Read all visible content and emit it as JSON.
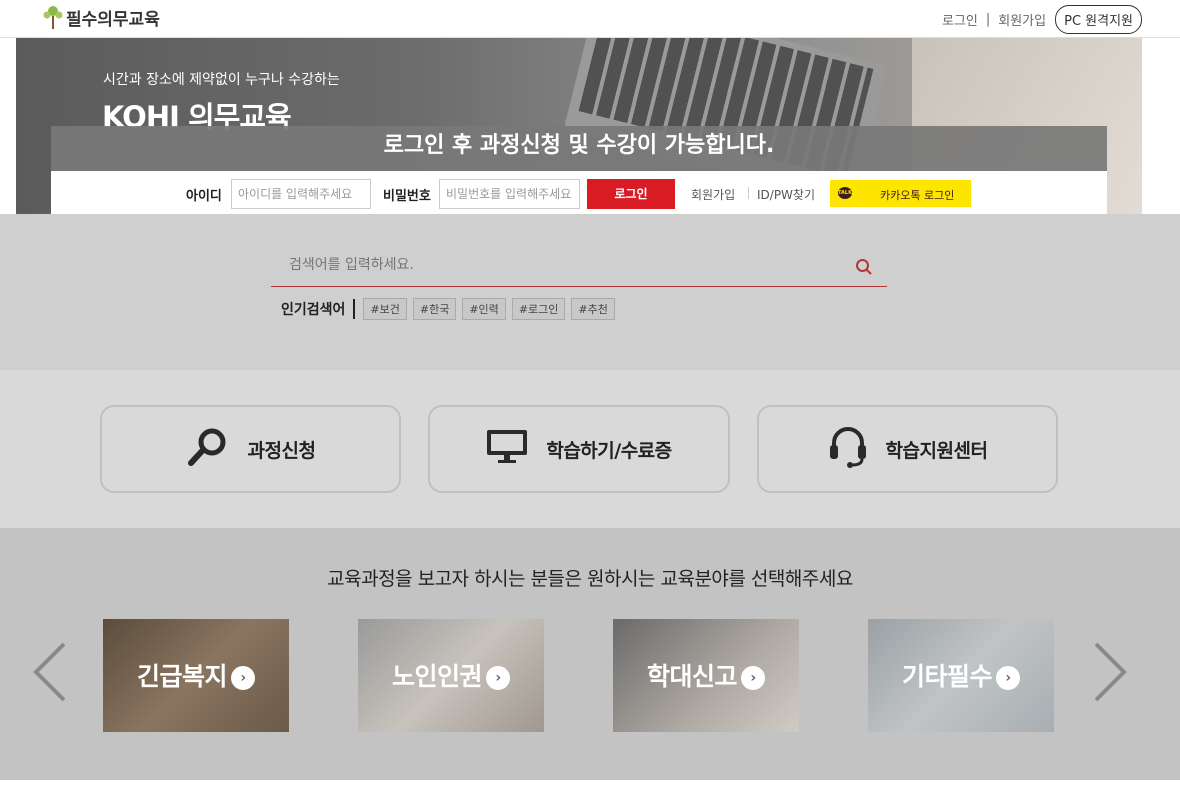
{
  "header": {
    "logo_text": "필수의무교육",
    "links": [
      "로그인",
      "회원가입"
    ],
    "remote_support": "PC 원격지원"
  },
  "hero": {
    "subtitle": "시간과 장소에 제약없이 누구나 수강하는",
    "title": "KOHI 의무교육"
  },
  "login": {
    "notice": "로그인 후 과정신청 및 수강이 가능합니다.",
    "id_label": "아이디",
    "id_placeholder": "아이디를 입력해주세요",
    "pw_label": "비밀번호",
    "pw_placeholder": "비밀번호를 입력해주세요",
    "login_button": "로그인",
    "signup_link": "회원가입",
    "find_link": "ID/PW찾기",
    "kakao_badge": "TALK",
    "kakao_button": "카카오톡 로그인"
  },
  "search": {
    "placeholder": "검색어를 입력하세요.",
    "popular_label": "인기검색어",
    "tags": [
      "#보건",
      "#한국",
      "#인력",
      "#로그인",
      "#추천"
    ]
  },
  "quick_menu": [
    {
      "label": "과정신청",
      "icon": "magnifier-icon"
    },
    {
      "label": "학습하기/수료증",
      "icon": "monitor-icon"
    },
    {
      "label": "학습지원센터",
      "icon": "headset-icon"
    }
  ],
  "courses": {
    "title": "교육과정을 보고자 하시는 분들은 원하시는 교육분야를 선택해주세요",
    "categories": [
      {
        "label": "긴급복지"
      },
      {
        "label": "노인인권"
      },
      {
        "label": "학대신고"
      },
      {
        "label": "기타필수"
      }
    ]
  },
  "colors": {
    "accent_red": "#d91c24",
    "kakao_yellow": "#fee500",
    "overlay": "#787878"
  }
}
